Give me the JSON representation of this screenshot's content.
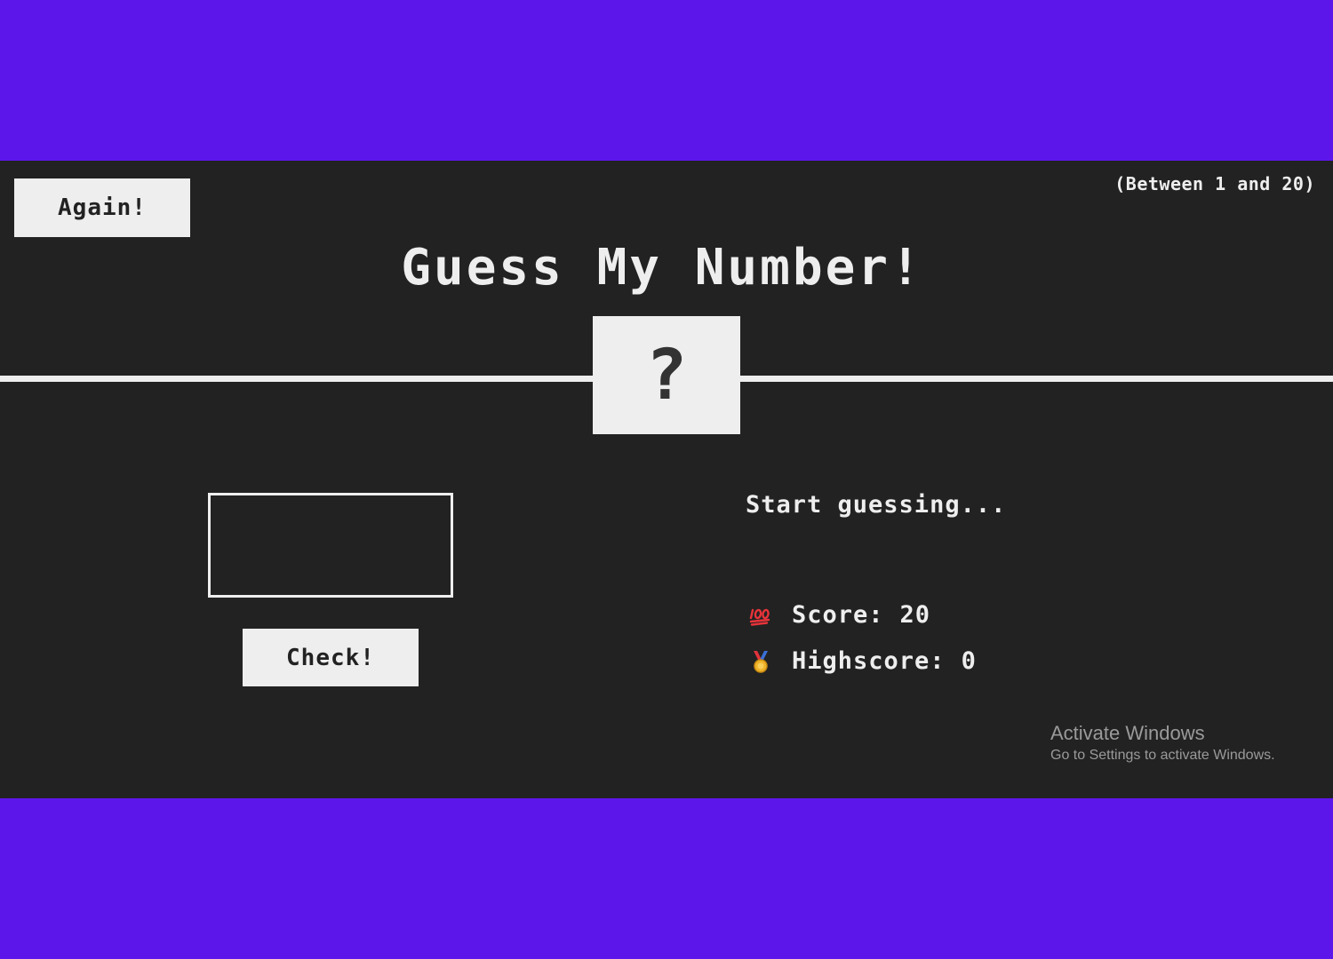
{
  "header": {
    "again_label": "Again!",
    "range_hint": "(Between 1 and 20)",
    "title": "Guess My Number!",
    "secret_display": "?"
  },
  "left": {
    "guess_value": "",
    "check_label": "Check!"
  },
  "right": {
    "message": "Start guessing...",
    "score_icon": "hundred-points-icon",
    "score_label": "Score:",
    "score_value": "20",
    "highscore_icon": "medal-icon",
    "highscore_label": "Highscore:",
    "highscore_value": "0"
  },
  "watermark": {
    "title": "Activate Windows",
    "subtitle": "Go to Settings to activate Windows."
  },
  "colors": {
    "page_background": "#5d16ea",
    "app_background": "#222222",
    "foreground": "#eeeeee"
  }
}
